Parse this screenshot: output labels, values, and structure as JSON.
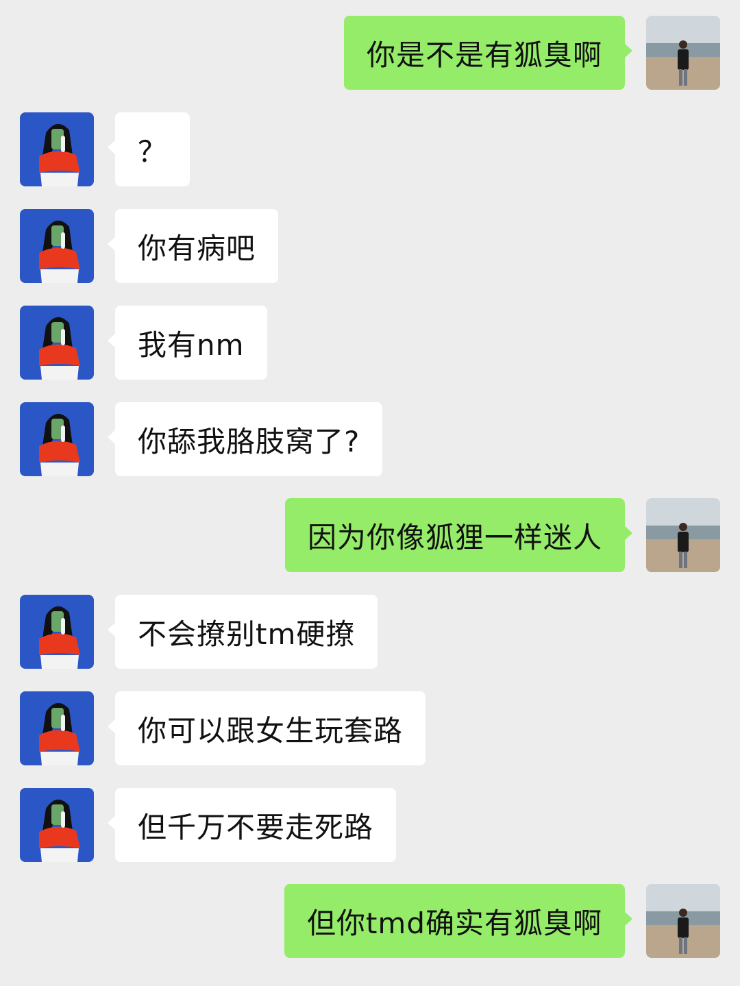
{
  "colors": {
    "background": "#ededed",
    "incoming_bubble": "#ffffff",
    "outgoing_bubble": "#95ec69",
    "her_avatar_bg": "#2b56c6",
    "her_avatar_accent": "#e8391f"
  },
  "avatars": {
    "her": "illustrated-woman-avatar",
    "me": "beach-photo-avatar"
  },
  "messages": [
    {
      "sender": "me",
      "text": "你是不是有狐臭啊"
    },
    {
      "sender": "her",
      "text": "？"
    },
    {
      "sender": "her",
      "text": "你有病吧"
    },
    {
      "sender": "her",
      "text": "我有nm"
    },
    {
      "sender": "her",
      "text": "你舔我胳肢窝了?"
    },
    {
      "sender": "me",
      "text": "因为你像狐狸一样迷人"
    },
    {
      "sender": "her",
      "text": "不会撩别tm硬撩"
    },
    {
      "sender": "her",
      "text": "你可以跟女生玩套路"
    },
    {
      "sender": "her",
      "text": "但千万不要走死路"
    },
    {
      "sender": "me",
      "text": "但你tmd确实有狐臭啊"
    }
  ]
}
